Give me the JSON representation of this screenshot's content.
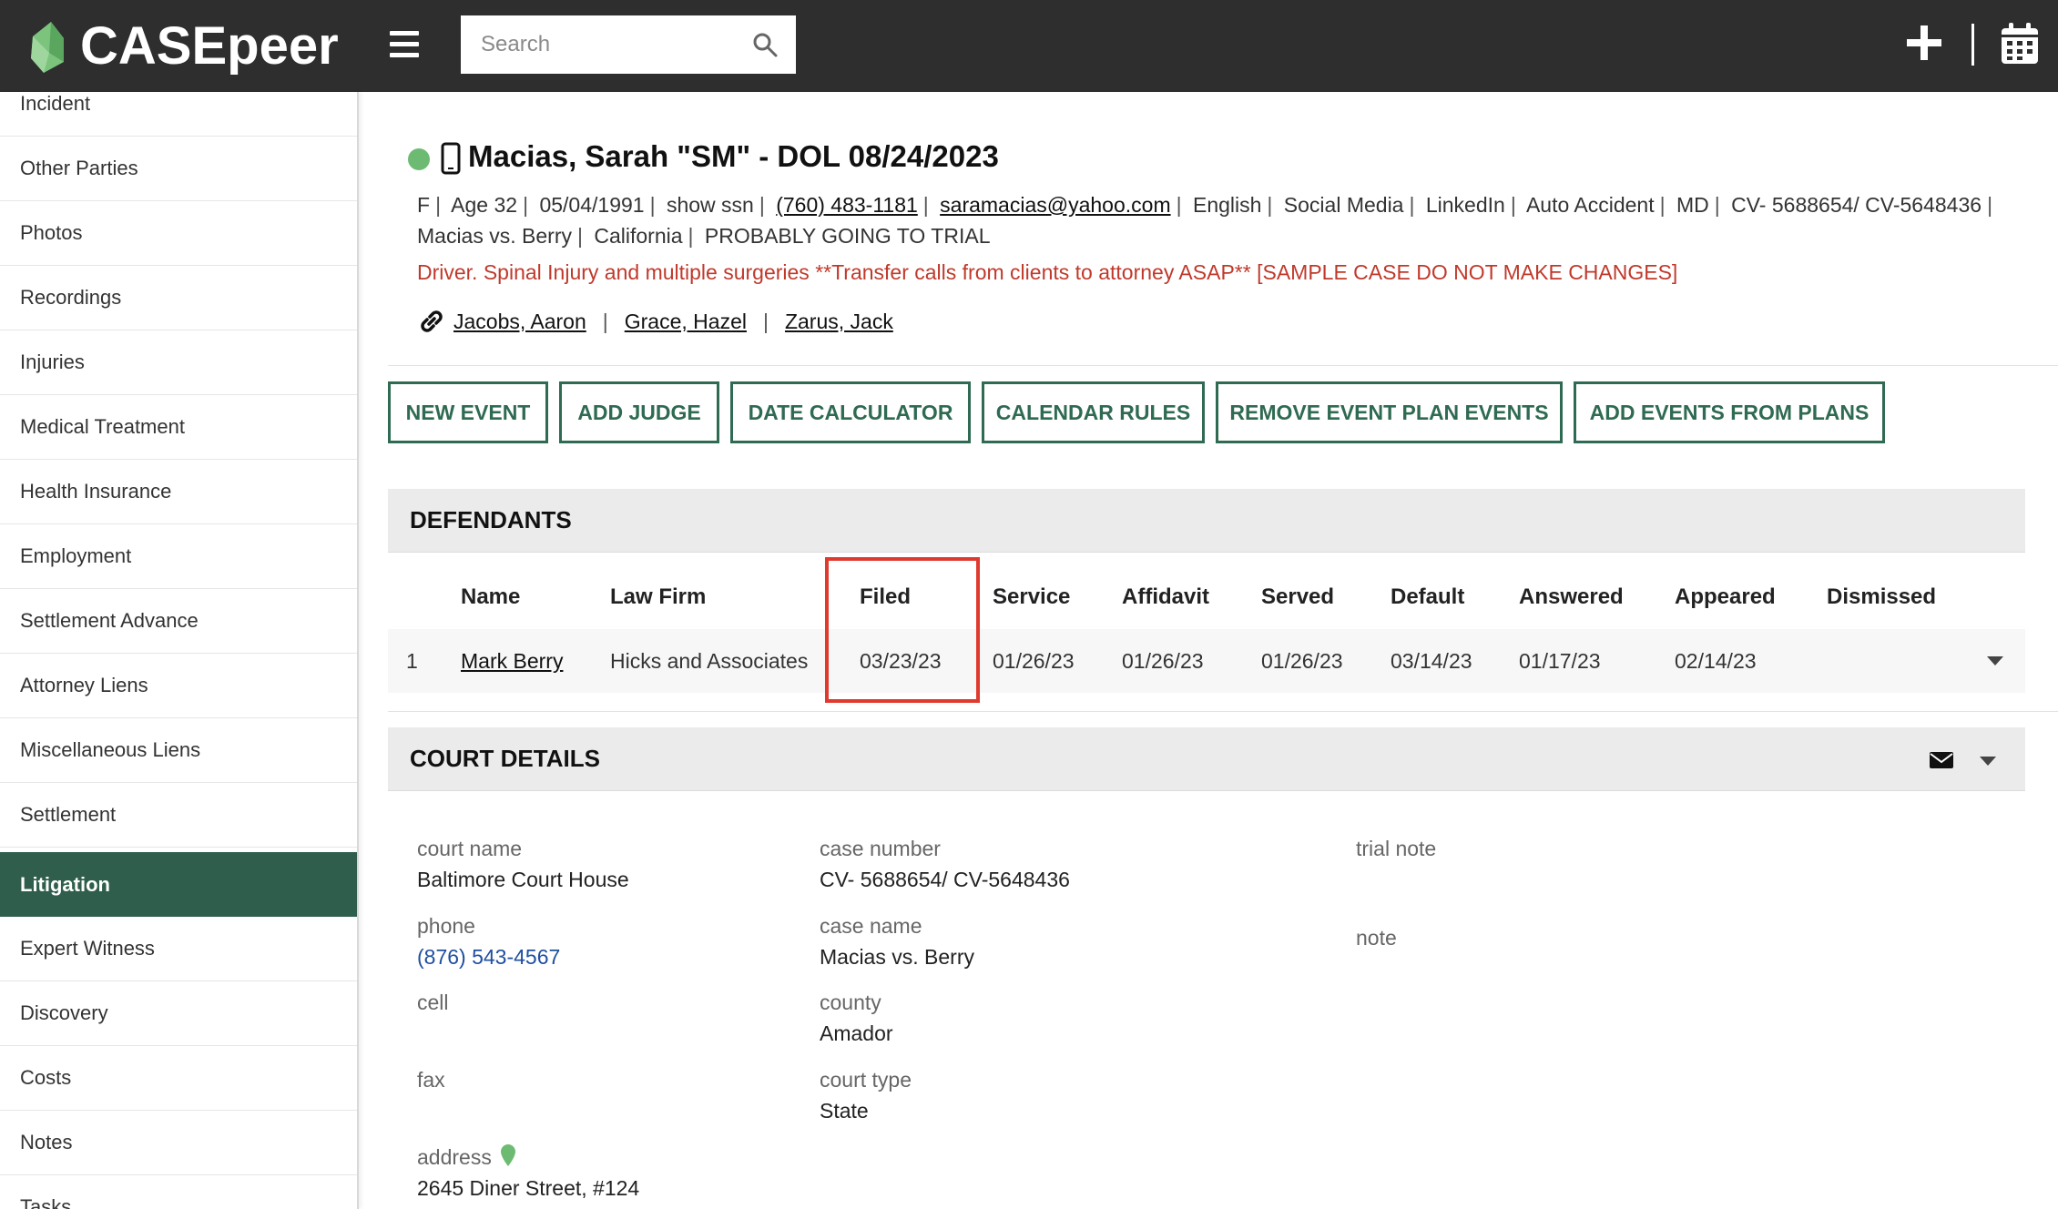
{
  "app": {
    "brand": "CASEpeer",
    "search_placeholder": "Search"
  },
  "sidebar": {
    "items": [
      {
        "label": "Incident"
      },
      {
        "label": "Other Parties"
      },
      {
        "label": "Photos"
      },
      {
        "label": "Recordings"
      },
      {
        "label": "Injuries"
      },
      {
        "label": "Medical Treatment"
      },
      {
        "label": "Health Insurance"
      },
      {
        "label": "Employment"
      },
      {
        "label": "Settlement Advance"
      },
      {
        "label": "Attorney Liens"
      },
      {
        "label": "Miscellaneous Liens"
      },
      {
        "label": "Settlement"
      },
      {
        "label": "Litigation"
      },
      {
        "label": "Expert Witness"
      },
      {
        "label": "Discovery"
      },
      {
        "label": "Costs"
      },
      {
        "label": "Notes"
      },
      {
        "label": "Tasks"
      }
    ],
    "active": "Litigation"
  },
  "case": {
    "title": "Macias, Sarah \"SM\" - DOL 08/24/2023",
    "gender": "F",
    "age": "Age 32",
    "dob": "05/04/1991",
    "ssn_toggle": "show ssn",
    "phone": "(760) 483-1181",
    "email": "saramacias@yahoo.com",
    "language": "English",
    "source": "Social Media",
    "source_detail": "LinkedIn",
    "case_type": "Auto Accident",
    "state_code": "MD",
    "case_numbers": "CV- 5688654/ CV-5648436",
    "case_name": "Macias vs. Berry",
    "jurisdiction": "California",
    "trial_status": "PROBABLY GOING TO TRIAL",
    "alert": "Driver. Spinal Injury and multiple surgeries **Transfer calls from clients to attorney ASAP** [SAMPLE CASE DO NOT MAKE CHANGES]",
    "related": [
      "Jacobs, Aaron",
      "Grace, Hazel",
      "Zarus, Jack"
    ],
    "status_color": "#6dbb73"
  },
  "actions": {
    "new_event": "NEW EVENT",
    "add_judge": "ADD JUDGE",
    "date_calculator": "DATE CALCULATOR",
    "calendar_rules": "CALENDAR RULES",
    "remove_event_plan_events": "REMOVE EVENT PLAN EVENTS",
    "add_events_from_plans": "ADD EVENTS FROM PLANS"
  },
  "defendants": {
    "title": "DEFENDANTS",
    "columns": [
      "Name",
      "Law Firm",
      "Filed",
      "Service",
      "Affidavit",
      "Served",
      "Default",
      "Answered",
      "Appeared",
      "Dismissed"
    ],
    "rows": [
      {
        "index": "1",
        "name": "Mark Berry",
        "law_firm": "Hicks and Associates",
        "filed": "03/23/23",
        "service": "01/26/23",
        "affidavit": "01/26/23",
        "served": "01/26/23",
        "default": "03/14/23",
        "answered": "01/17/23",
        "appeared": "02/14/23",
        "dismissed": ""
      }
    ]
  },
  "court": {
    "title": "COURT DETAILS",
    "labels": {
      "court_name": "court name",
      "phone": "phone",
      "cell": "cell",
      "fax": "fax",
      "address": "address",
      "case_number": "case number",
      "case_name": "case name",
      "county": "county",
      "court_type": "court type",
      "trial_note": "trial note",
      "note": "note"
    },
    "values": {
      "court_name": "Baltimore Court House",
      "phone": "(876) 543-4567",
      "address": "2645 Diner Street, #124",
      "case_number": "CV- 5688654/ CV-5648436",
      "case_name": "Macias vs. Berry",
      "county": "Amador",
      "court_type": "State"
    }
  },
  "colors": {
    "topbar": "#2e2e2e",
    "accent_green": "#2f6a52",
    "sidebar_active": "#2f5e4c",
    "alert_red": "#c0392b",
    "highlight_red": "#e03a2e"
  }
}
